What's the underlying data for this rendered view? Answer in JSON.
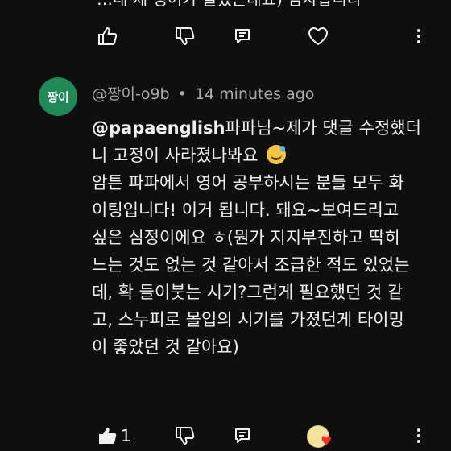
{
  "previous_comment": {
    "cut_text": "…네 제 영어가 늘었는데요) 감사합니다"
  },
  "comment": {
    "avatar_text": "짱이",
    "author": "@짱이-o9b",
    "separator": "•",
    "timestamp": "14 minutes ago",
    "mention": "@papaenglish",
    "lines": [
      "파파님~제가 댓글 수정했더",
      "니 고정이 사라졌나봐요",
      "암튼 파파에서 영어 공부하시는 분들 모두 화",
      "이팅입니다! 이거 됩니다. 돼요~보여드리고",
      "싶은 심정이에요 ㅎ(뭔가 지지부진하고 딱히",
      "느는 것도 없는 것 같아서 조급한 적도 있었는",
      "데, 확 들이붓는 시기?그런게 필요했던 것 같",
      "고, 스누피로 몰입의 시기를 가졌던게 타이밍",
      "이 좋았던 것 같아요)"
    ],
    "like_count": "1",
    "creator_heart_badge": "♥"
  },
  "icons": {
    "like": "thumbs-up-icon",
    "dislike": "thumbs-down-icon",
    "reply": "reply-icon",
    "heart": "heart-outline-icon",
    "more": "more-vertical-icon",
    "emoji": "grinning-sweat-emoji-icon",
    "creator_heart": "creator-heart-icon"
  },
  "colors": {
    "background": "#0f0f0f",
    "text": "#f1f1f1",
    "secondary_text": "#aaaaaa",
    "avatar_bg": "#1f8a57",
    "heart_badge": "#ff2b2b"
  }
}
